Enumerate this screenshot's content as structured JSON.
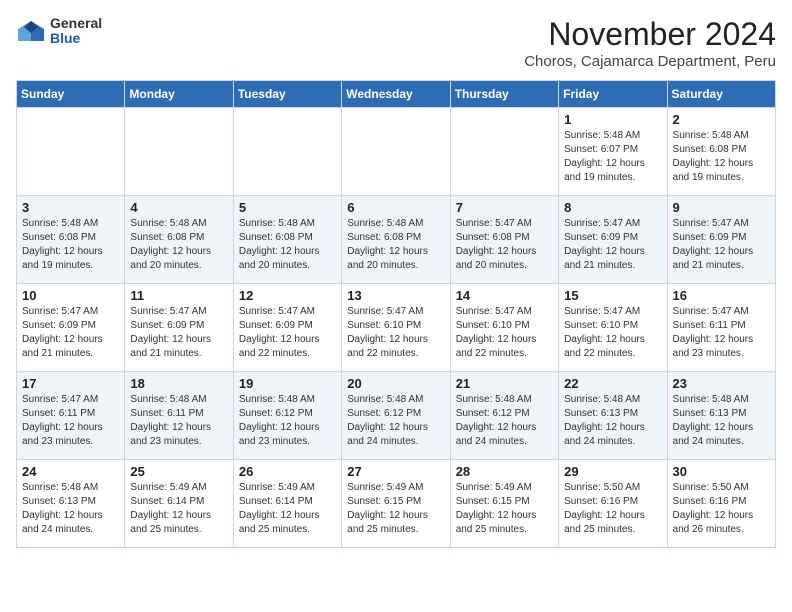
{
  "logo": {
    "general": "General",
    "blue": "Blue"
  },
  "title": "November 2024",
  "location": "Choros, Cajamarca Department, Peru",
  "weekdays": [
    "Sunday",
    "Monday",
    "Tuesday",
    "Wednesday",
    "Thursday",
    "Friday",
    "Saturday"
  ],
  "weeks": [
    [
      {
        "day": "",
        "info": ""
      },
      {
        "day": "",
        "info": ""
      },
      {
        "day": "",
        "info": ""
      },
      {
        "day": "",
        "info": ""
      },
      {
        "day": "",
        "info": ""
      },
      {
        "day": "1",
        "info": "Sunrise: 5:48 AM\nSunset: 6:07 PM\nDaylight: 12 hours and 19 minutes."
      },
      {
        "day": "2",
        "info": "Sunrise: 5:48 AM\nSunset: 6:08 PM\nDaylight: 12 hours and 19 minutes."
      }
    ],
    [
      {
        "day": "3",
        "info": "Sunrise: 5:48 AM\nSunset: 6:08 PM\nDaylight: 12 hours and 19 minutes."
      },
      {
        "day": "4",
        "info": "Sunrise: 5:48 AM\nSunset: 6:08 PM\nDaylight: 12 hours and 20 minutes."
      },
      {
        "day": "5",
        "info": "Sunrise: 5:48 AM\nSunset: 6:08 PM\nDaylight: 12 hours and 20 minutes."
      },
      {
        "day": "6",
        "info": "Sunrise: 5:48 AM\nSunset: 6:08 PM\nDaylight: 12 hours and 20 minutes."
      },
      {
        "day": "7",
        "info": "Sunrise: 5:47 AM\nSunset: 6:08 PM\nDaylight: 12 hours and 20 minutes."
      },
      {
        "day": "8",
        "info": "Sunrise: 5:47 AM\nSunset: 6:09 PM\nDaylight: 12 hours and 21 minutes."
      },
      {
        "day": "9",
        "info": "Sunrise: 5:47 AM\nSunset: 6:09 PM\nDaylight: 12 hours and 21 minutes."
      }
    ],
    [
      {
        "day": "10",
        "info": "Sunrise: 5:47 AM\nSunset: 6:09 PM\nDaylight: 12 hours and 21 minutes."
      },
      {
        "day": "11",
        "info": "Sunrise: 5:47 AM\nSunset: 6:09 PM\nDaylight: 12 hours and 21 minutes."
      },
      {
        "day": "12",
        "info": "Sunrise: 5:47 AM\nSunset: 6:09 PM\nDaylight: 12 hours and 22 minutes."
      },
      {
        "day": "13",
        "info": "Sunrise: 5:47 AM\nSunset: 6:10 PM\nDaylight: 12 hours and 22 minutes."
      },
      {
        "day": "14",
        "info": "Sunrise: 5:47 AM\nSunset: 6:10 PM\nDaylight: 12 hours and 22 minutes."
      },
      {
        "day": "15",
        "info": "Sunrise: 5:47 AM\nSunset: 6:10 PM\nDaylight: 12 hours and 22 minutes."
      },
      {
        "day": "16",
        "info": "Sunrise: 5:47 AM\nSunset: 6:11 PM\nDaylight: 12 hours and 23 minutes."
      }
    ],
    [
      {
        "day": "17",
        "info": "Sunrise: 5:47 AM\nSunset: 6:11 PM\nDaylight: 12 hours and 23 minutes."
      },
      {
        "day": "18",
        "info": "Sunrise: 5:48 AM\nSunset: 6:11 PM\nDaylight: 12 hours and 23 minutes."
      },
      {
        "day": "19",
        "info": "Sunrise: 5:48 AM\nSunset: 6:12 PM\nDaylight: 12 hours and 23 minutes."
      },
      {
        "day": "20",
        "info": "Sunrise: 5:48 AM\nSunset: 6:12 PM\nDaylight: 12 hours and 24 minutes."
      },
      {
        "day": "21",
        "info": "Sunrise: 5:48 AM\nSunset: 6:12 PM\nDaylight: 12 hours and 24 minutes."
      },
      {
        "day": "22",
        "info": "Sunrise: 5:48 AM\nSunset: 6:13 PM\nDaylight: 12 hours and 24 minutes."
      },
      {
        "day": "23",
        "info": "Sunrise: 5:48 AM\nSunset: 6:13 PM\nDaylight: 12 hours and 24 minutes."
      }
    ],
    [
      {
        "day": "24",
        "info": "Sunrise: 5:48 AM\nSunset: 6:13 PM\nDaylight: 12 hours and 24 minutes."
      },
      {
        "day": "25",
        "info": "Sunrise: 5:49 AM\nSunset: 6:14 PM\nDaylight: 12 hours and 25 minutes."
      },
      {
        "day": "26",
        "info": "Sunrise: 5:49 AM\nSunset: 6:14 PM\nDaylight: 12 hours and 25 minutes."
      },
      {
        "day": "27",
        "info": "Sunrise: 5:49 AM\nSunset: 6:15 PM\nDaylight: 12 hours and 25 minutes."
      },
      {
        "day": "28",
        "info": "Sunrise: 5:49 AM\nSunset: 6:15 PM\nDaylight: 12 hours and 25 minutes."
      },
      {
        "day": "29",
        "info": "Sunrise: 5:50 AM\nSunset: 6:16 PM\nDaylight: 12 hours and 25 minutes."
      },
      {
        "day": "30",
        "info": "Sunrise: 5:50 AM\nSunset: 6:16 PM\nDaylight: 12 hours and 26 minutes."
      }
    ]
  ]
}
